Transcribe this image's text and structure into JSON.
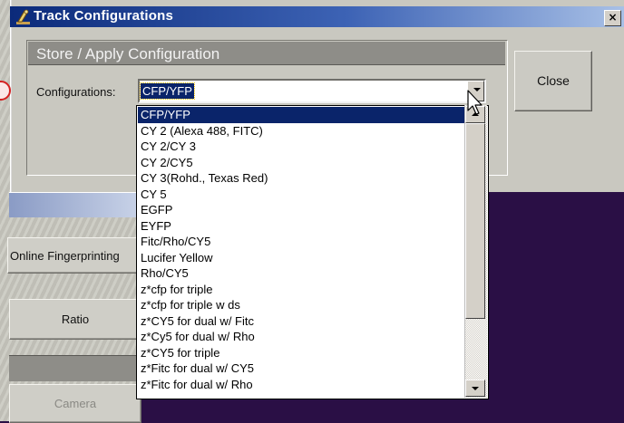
{
  "window": {
    "title": "Track Configurations",
    "close_glyph": "×"
  },
  "group": {
    "title": "Store / Apply Configuration",
    "config_label": "Configurations:",
    "selected_value": "CFP/YFP"
  },
  "buttons": {
    "close": "Close"
  },
  "dropdown": {
    "items": [
      "CFP/YFP",
      "CY 2 (Alexa 488, FITC)",
      "CY 2/CY 3",
      "CY 2/CY5",
      "CY 3(Rohd., Texas Red)",
      "CY 5",
      "EGFP",
      "EYFP",
      "Fitc/Rho/CY5",
      "Lucifer Yellow",
      "Rho/CY5",
      "z*cfp for triple",
      "z*cfp for triple w ds",
      "z*CY5 for dual w/ Fitc",
      "z*Cy5 for dual w/ Rho",
      "z*CY5 for triple",
      "z*Fitc for dual w/ CY5",
      "z*Fitc for dual w/ Rho"
    ],
    "selected_index": 0
  },
  "background": {
    "online_fingerprinting": "Online Fingerprinting",
    "ratio": "Ratio",
    "camera": "Camera"
  },
  "colors": {
    "title_start": "#0b2a7a",
    "title_end": "#a8c0e6",
    "selection": "#0a246a",
    "background": "#2a0f45",
    "marker": "#d42020"
  },
  "icons": {
    "title_icon": "microscope-icon",
    "close": "close-icon",
    "combo_arrow": "chevron-down-icon",
    "scroll_up": "arrow-up-icon",
    "scroll_down": "arrow-down-icon",
    "cursor": "mouse-pointer-icon"
  }
}
